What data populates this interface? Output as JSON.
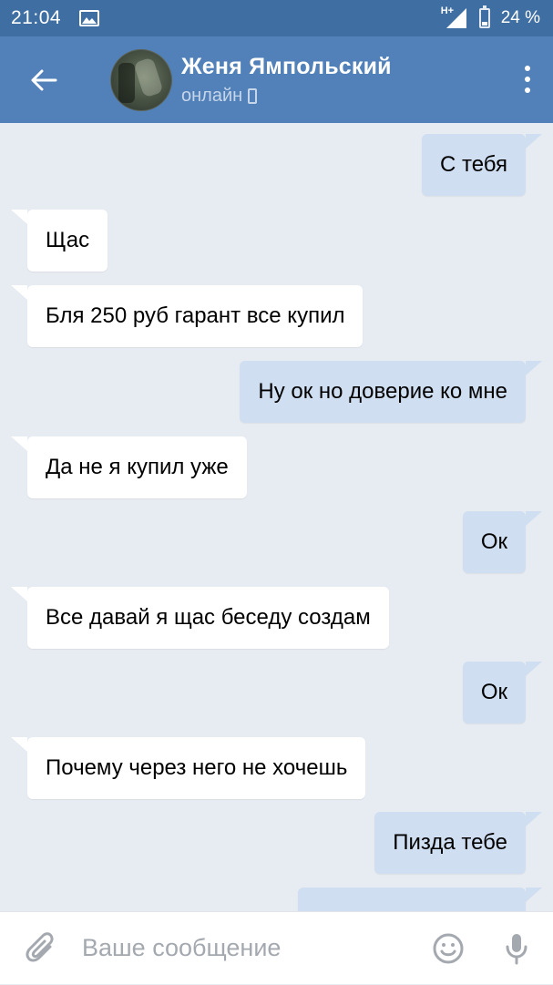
{
  "status_bar": {
    "time": "21:04",
    "network_label": "H+",
    "battery_percent": "24 %",
    "battery_level": 0.24
  },
  "header": {
    "contact_name": "Женя Ямпольский",
    "contact_status": "онлайн"
  },
  "messages": [
    {
      "direction": "out",
      "text": "С тебя"
    },
    {
      "direction": "in",
      "text": "Щас"
    },
    {
      "direction": "in",
      "text": "Бля 250 руб гарант все купил"
    },
    {
      "direction": "out",
      "text": "Ну ок но доверие ко мне"
    },
    {
      "direction": "in",
      "text": "Да не я купил уже"
    },
    {
      "direction": "out",
      "text": "Ок"
    },
    {
      "direction": "in",
      "text": "Все давай я щас беседу создам"
    },
    {
      "direction": "out",
      "text": "Ок"
    },
    {
      "direction": "in",
      "text": "Почему через него не хочешь"
    },
    {
      "direction": "out",
      "text": "Пизда тебе"
    },
    {
      "direction": "out",
      "text": ""
    }
  ],
  "composer": {
    "placeholder": "Ваше сообщение",
    "value": ""
  },
  "colors": {
    "status_bar": "#3f6ea3",
    "header": "#5181b8",
    "chat_background": "#e7ecf2",
    "incoming_bubble": "#ffffff",
    "outgoing_bubble": "#cfdef1"
  }
}
